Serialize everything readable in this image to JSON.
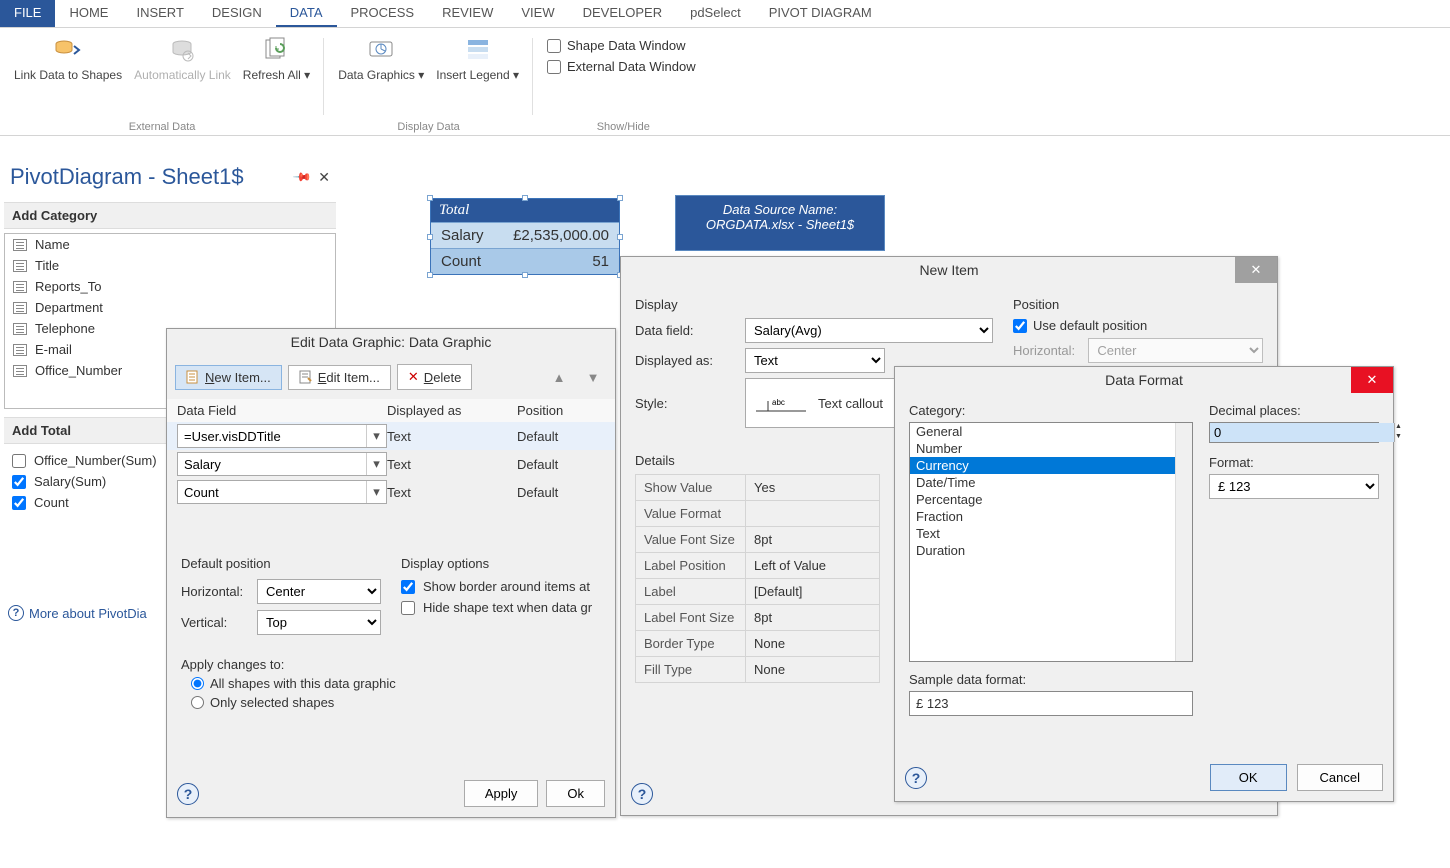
{
  "ribbon": {
    "tabs": [
      "FILE",
      "HOME",
      "INSERT",
      "DESIGN",
      "DATA",
      "PROCESS",
      "REVIEW",
      "VIEW",
      "DEVELOPER",
      "pdSelect",
      "PIVOT DIAGRAM"
    ],
    "active": "DATA",
    "items": {
      "link_data": "Link Data to Shapes",
      "auto_link": "Automatically Link",
      "refresh": "Refresh All ▾",
      "data_graphics": "Data Graphics ▾",
      "insert_legend": "Insert Legend ▾"
    },
    "groups": {
      "external": "External Data",
      "display": "Display Data",
      "showhide": "Show/Hide"
    },
    "checks": {
      "shape_data": "Shape Data Window",
      "external_data": "External Data Window"
    }
  },
  "pivot": {
    "title": "PivotDiagram - Sheet1$",
    "add_category": "Add Category",
    "categories": [
      "Name",
      "Title",
      "Reports_To",
      "Department",
      "Telephone",
      "E-mail",
      "Office_Number"
    ],
    "add_total": "Add Total",
    "totals": [
      {
        "label": "Office_Number(Sum)",
        "checked": false
      },
      {
        "label": "Salary(Sum)",
        "checked": true
      },
      {
        "label": "Count",
        "checked": true
      }
    ],
    "more": "More about PivotDia"
  },
  "shapes": {
    "total_header": "Total",
    "salary_label": "Salary",
    "salary_value": "£2,535,000.00",
    "count_label": "Count",
    "count_value": "51",
    "ds_name_label": "Data Source Name:",
    "ds_name_value": "ORGDATA.xlsx - Sheet1$"
  },
  "edg": {
    "title": "Edit Data Graphic: Data Graphic",
    "new_item": "New Item...",
    "edit_item": "Edit Item...",
    "delete": "Delete",
    "headers": {
      "df": "Data Field",
      "da": "Displayed as",
      "pos": "Position"
    },
    "rows": [
      {
        "df": "=User.visDDTitle",
        "da": "Text",
        "pos": "Default"
      },
      {
        "df": "Salary",
        "da": "Text",
        "pos": "Default"
      },
      {
        "df": "Count",
        "da": "Text",
        "pos": "Default"
      }
    ],
    "default_pos": "Default position",
    "display_opts": "Display options",
    "horizontal": "Horizontal:",
    "vertical": "Vertical:",
    "h_val": "Center",
    "v_val": "Top",
    "show_border": "Show border around items at",
    "hide_shape": "Hide shape text when data gr",
    "apply_hdr": "Apply changes to:",
    "apply_all": "All shapes with this data graphic",
    "apply_sel": "Only selected shapes",
    "apply_btn": "Apply",
    "ok_btn": "Ok"
  },
  "newitem": {
    "title": "New Item",
    "display": "Display",
    "position": "Position",
    "data_field": "Data field:",
    "data_field_val": "Salary(Avg)",
    "displayed_as": "Displayed as:",
    "displayed_as_val": "Text",
    "style": "Style:",
    "style_val": "Text callout",
    "use_default": "Use default position",
    "horizontal": "Horizontal:",
    "h_val": "Center",
    "details": "Details",
    "rows": [
      {
        "k": "Show Value",
        "v": "Yes"
      },
      {
        "k": "Value Format",
        "v": ""
      },
      {
        "k": "Value Font Size",
        "v": "8pt"
      },
      {
        "k": "Label Position",
        "v": "Left of Value"
      },
      {
        "k": "Label",
        "v": "[Default]"
      },
      {
        "k": "Label Font Size",
        "v": "8pt"
      },
      {
        "k": "Border Type",
        "v": "None"
      },
      {
        "k": "Fill Type",
        "v": "None"
      }
    ]
  },
  "dformat": {
    "title": "Data Format",
    "category": "Category:",
    "categories": [
      "General",
      "Number",
      "Currency",
      "Date/Time",
      "Percentage",
      "Fraction",
      "Text",
      "Duration"
    ],
    "selected": "Currency",
    "decimal": "Decimal places:",
    "decimal_val": "0",
    "format": "Format:",
    "format_val": "£ 123",
    "sample_lbl": "Sample data format:",
    "sample_val": "£ 123",
    "ok": "OK",
    "cancel": "Cancel"
  }
}
